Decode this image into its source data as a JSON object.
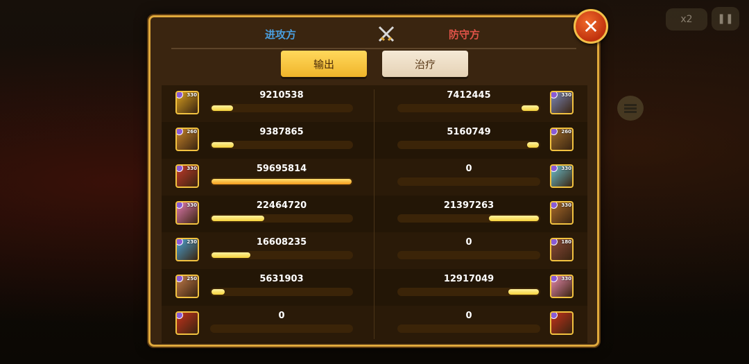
{
  "background": {
    "speed_label": "x2"
  },
  "header": {
    "attacker_label": "进攻方",
    "defender_label": "防守方"
  },
  "tabs": [
    {
      "label": "输出",
      "active": true
    },
    {
      "label": "治疗",
      "active": false
    }
  ],
  "rows": [
    {
      "left": {
        "value": "9210538",
        "level": "330",
        "color": "#d8a020",
        "fill": 0.154
      },
      "right": {
        "value": "7412445",
        "level": "330",
        "color": "#7a86b8",
        "fill": 0.124
      }
    },
    {
      "left": {
        "value": "9387865",
        "level": "260",
        "color": "#c4822a",
        "fill": 0.157
      },
      "right": {
        "value": "5160749",
        "level": "260",
        "color": "#9a6a2a",
        "fill": 0.086
      }
    },
    {
      "left": {
        "value": "59695814",
        "level": "330",
        "color": "#c23a2a",
        "fill": 1.0
      },
      "right": {
        "value": "0",
        "level": "330",
        "color": "#6ac0d0",
        "fill": 0
      }
    },
    {
      "left": {
        "value": "22464720",
        "level": "330",
        "color": "#e07ab0",
        "fill": 0.376
      },
      "right": {
        "value": "21397263",
        "level": "330",
        "color": "#a86a2a",
        "fill": 0.358
      }
    },
    {
      "left": {
        "value": "16608235",
        "level": "230",
        "color": "#4aa0d0",
        "fill": 0.278
      },
      "right": {
        "value": "0",
        "level": "180",
        "color": "#8a4a3a",
        "fill": 0
      }
    },
    {
      "left": {
        "value": "5631903",
        "level": "250",
        "color": "#c07a4a",
        "fill": 0.094
      },
      "right": {
        "value": "12917049",
        "level": "330",
        "color": "#e88ab0",
        "fill": 0.216
      }
    },
    {
      "left": {
        "value": "0",
        "level": "",
        "color": "#c2321c",
        "fill": 0
      },
      "right": {
        "value": "0",
        "level": "",
        "color": "#c2321c",
        "fill": 0
      }
    }
  ]
}
